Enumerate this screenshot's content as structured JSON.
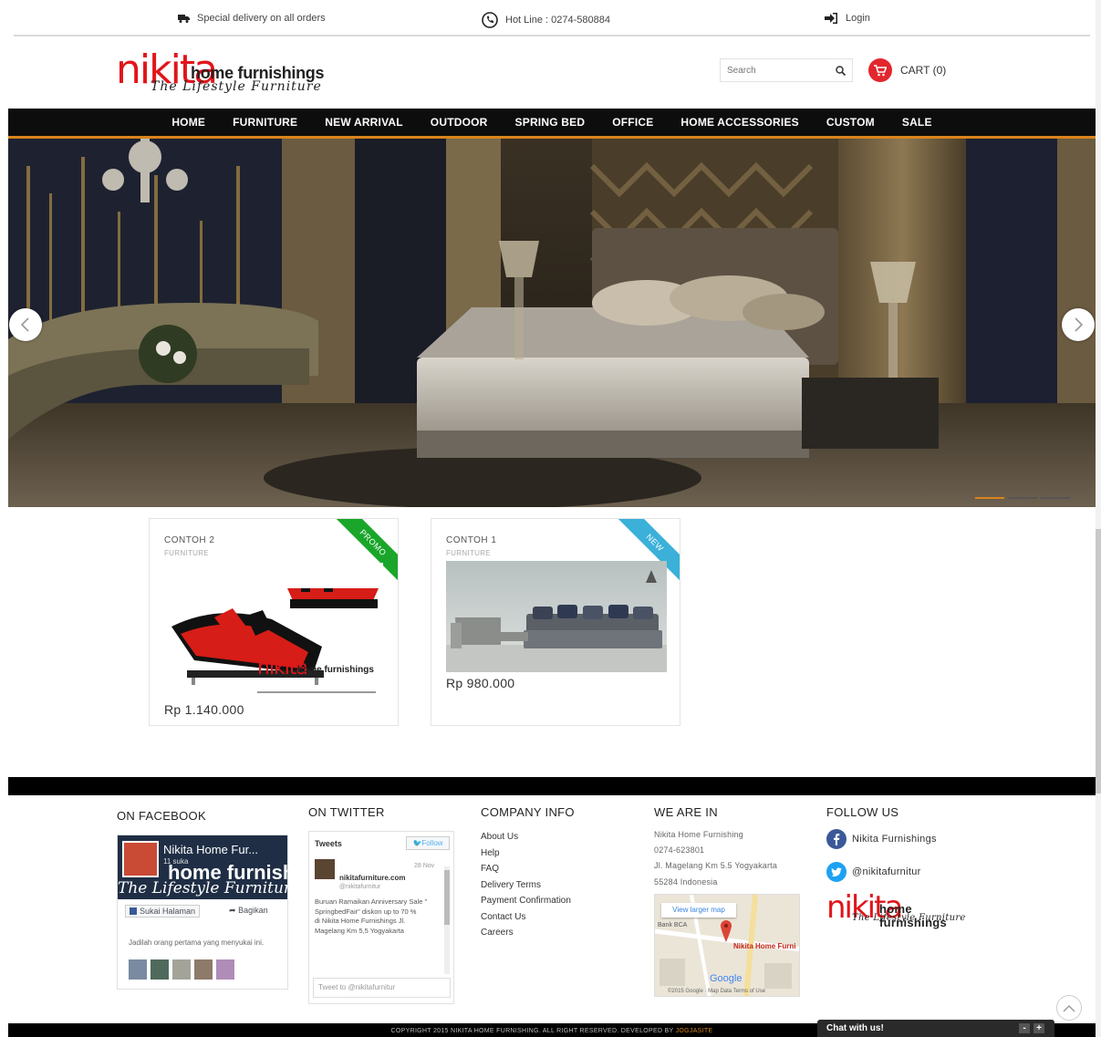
{
  "topbar": {
    "delivery": "Special delivery on all orders",
    "hotline": "Hot Line : 0274-580884",
    "login": "Login"
  },
  "logo": {
    "mark": "nikita",
    "brand": "home furnishings",
    "tagline": "The Lifestyle Furniture"
  },
  "search": {
    "placeholder": "Search"
  },
  "cart": {
    "label": "CART (0)"
  },
  "nav": {
    "items": [
      "HOME",
      "FURNITURE",
      "NEW ARRIVAL",
      "OUTDOOR",
      "SPRING BED",
      "OFFICE",
      "HOME ACCESSORIES",
      "CUSTOM",
      "SALE"
    ]
  },
  "products": [
    {
      "name": "CONTOH 2",
      "category": "FURNITURE",
      "price": "Rp 1.140.000",
      "badge": "PROMO",
      "image_brand": "home furnishings"
    },
    {
      "name": "CONTOH 1",
      "category": "FURNITURE",
      "price": "Rp 980.000",
      "badge": "NEW"
    }
  ],
  "footer": {
    "facebook": {
      "heading": "ON FACEBOOK",
      "page_name": "Nikita Home Fur...",
      "likes": "11 suka",
      "like_button": "Sukai Halaman",
      "share_button": "Bagikan",
      "prompt": "Jadilah orang pertama yang menyukai ini."
    },
    "twitter": {
      "heading": "ON TWITTER",
      "tweets_label": "Tweets",
      "follow_label": "Follow",
      "date": "28 Nov",
      "account_name": "nikitafurniture.com",
      "handle": "@nikitafurnitur",
      "tweet_text": "Buruan Ramaikan Anniversary Sale \" SpringbedFair\" diskon up to 70 %",
      "tweet_text2": "di Nikita Home Furnishings Jl. Magelang Km 5,5 Yogyakarta",
      "tweet_placeholder": "Tweet to @nikitafurnitur"
    },
    "company": {
      "heading": "COMPANY INFO",
      "links": [
        "About Us",
        "Help",
        "FAQ",
        "Delivery Terms",
        "Payment Confirmation",
        "Contact Us",
        "Careers"
      ]
    },
    "location": {
      "heading": "WE ARE IN",
      "lines": [
        "Nikita Home Furnishing",
        "0274-623801",
        "Jl. Magelang Km 5.5 Yogyakarta",
        "55284 Indonesia"
      ],
      "map_link": "View larger map",
      "map_pin_label": "Nikita Home Furni",
      "map_poi": "Bank BCA",
      "map_footer": "©2015 Google · Map Data   Terms of Use",
      "google": "Google"
    },
    "follow": {
      "heading": "FOLLOW US",
      "facebook": "Nikita Furnishings",
      "twitter": "@nikitafurnitur"
    }
  },
  "copyright": {
    "text": "COPYRIGHT 2015 NIKITA HOME FURNISHING. ALL RIGHT RESERVED. DEVELOPED BY",
    "developer": "JOGJASITE"
  },
  "chat": {
    "label": "Chat with us!",
    "minimize": "-",
    "expand": "+"
  },
  "colors": {
    "accent": "#d9831c",
    "brand_red": "#e0161b",
    "promo": "#1aa62a",
    "new": "#3bb0d9",
    "nav_bg": "#0d0d0d"
  }
}
